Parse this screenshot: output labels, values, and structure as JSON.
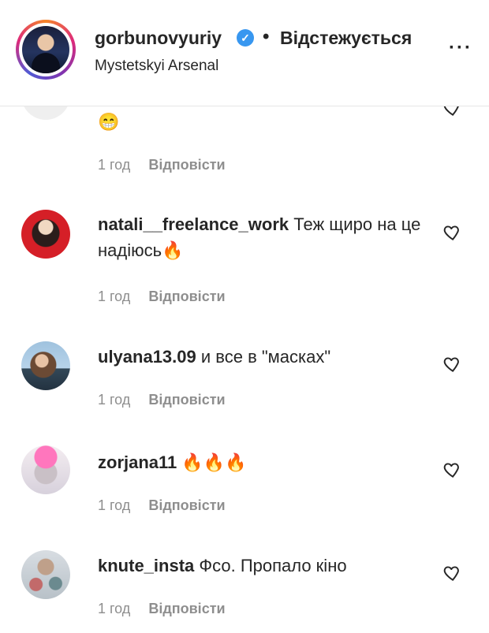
{
  "header": {
    "username": "gorbunovyuriy",
    "verified_icon": "verified-badge-icon",
    "separator": "•",
    "follow_status": "Відстежується",
    "location": "Mystetskyi Arsenal",
    "more": "···"
  },
  "comments": [
    {
      "username": "",
      "text": "😁",
      "time": "1 год",
      "reply": "Відповісти"
    },
    {
      "username": "natali__freelance_work",
      "text": "Теж щиро на це надіюсь🔥",
      "time": "1 год",
      "reply": "Відповісти"
    },
    {
      "username": "ulyana13.09",
      "text": "и все в \"масках\"",
      "time": "1 год",
      "reply": "Відповісти"
    },
    {
      "username": "zorjana11",
      "text": "🔥🔥🔥",
      "time": "1 год",
      "reply": "Відповісти"
    },
    {
      "username": "knute_insta",
      "text": "Фсо. Пропало кіно",
      "time": "1 год",
      "reply": "Відповісти"
    }
  ],
  "colors": {
    "text": "#262626",
    "meta": "#8e8e8e",
    "verified": "#3897f0"
  },
  "icons": {
    "like": "heart-outline-icon",
    "menu": "more-horizontal-icon"
  }
}
